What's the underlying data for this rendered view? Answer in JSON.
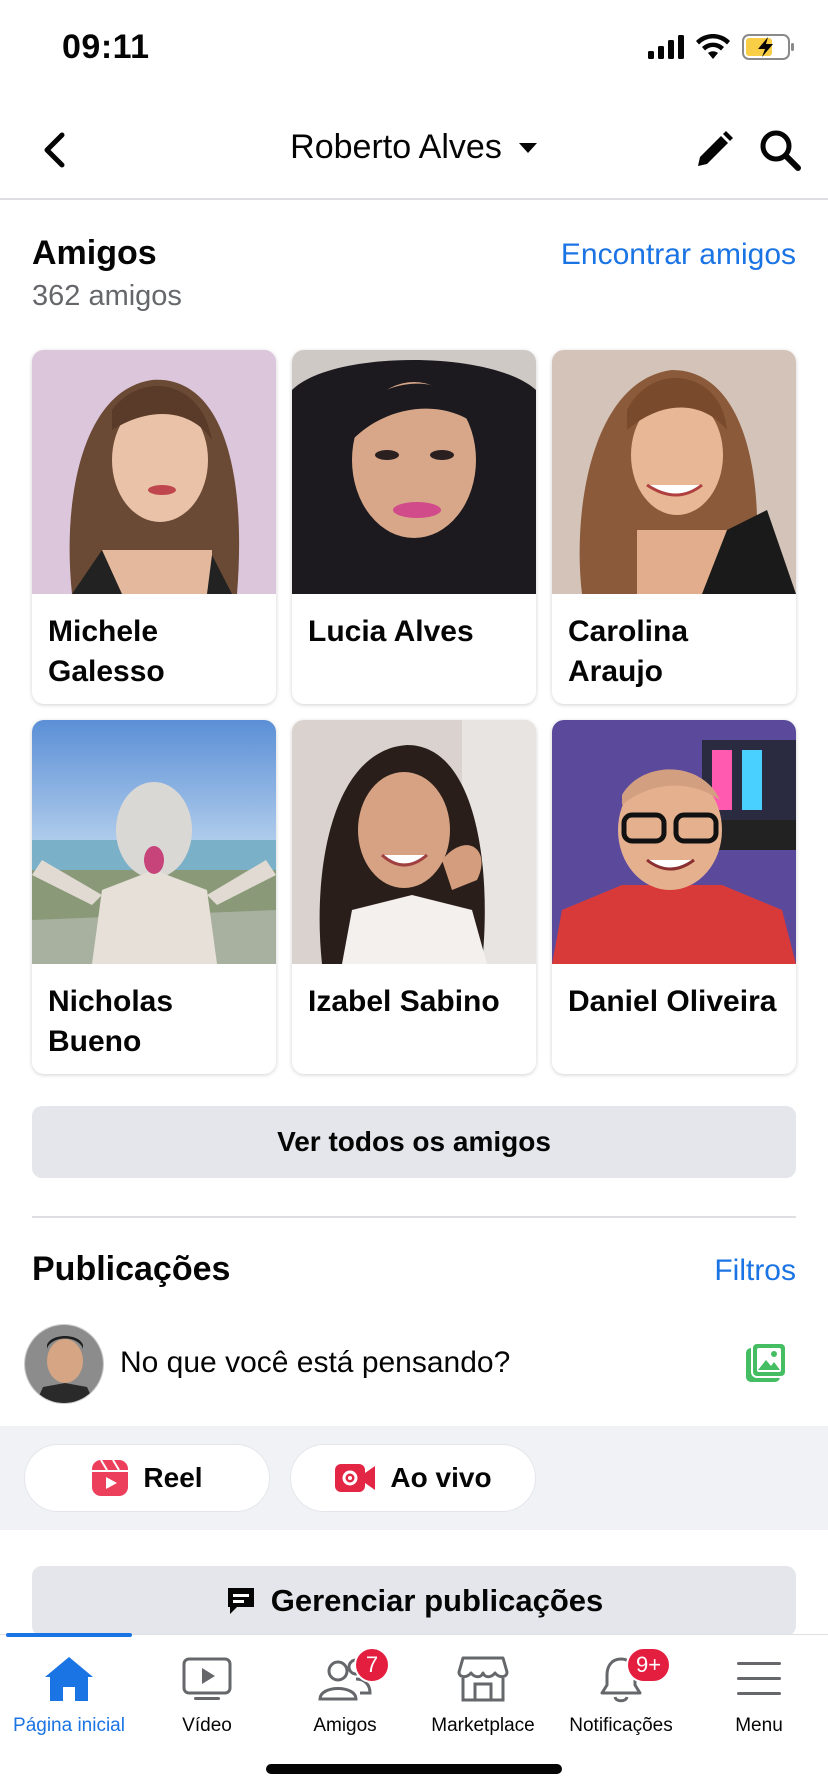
{
  "status_bar": {
    "time": "09:11"
  },
  "header": {
    "title": "Roberto Alves"
  },
  "friends": {
    "title": "Amigos",
    "link": "Encontrar amigos",
    "count": "362 amigos",
    "items": [
      {
        "name": "Michele Galesso",
        "bg": "#d9c0d6"
      },
      {
        "name": "Lucia Alves",
        "bg": "#c8c4c2"
      },
      {
        "name": "Carolina Araujo",
        "bg": "#c9b8ad"
      },
      {
        "name": "Nicholas Bueno",
        "bg": "#7eaad6"
      },
      {
        "name": "Izabel Sabino",
        "bg": "#d8d0cc"
      },
      {
        "name": "Daniel Oliveira",
        "bg": "#6d5aa8"
      }
    ],
    "see_all": "Ver todos os amigos"
  },
  "posts": {
    "title": "Publicações",
    "link": "Filtros",
    "composer_placeholder": "No que você está pensando?",
    "reel_label": "Reel",
    "live_label": "Ao vivo",
    "manage_label": "Gerenciar publicações"
  },
  "tabs": [
    {
      "label": "Página inicial",
      "icon": "home-icon"
    },
    {
      "label": "Vídeo",
      "icon": "video-icon"
    },
    {
      "label": "Amigos",
      "icon": "friends-icon",
      "badge": "7"
    },
    {
      "label": "Marketplace",
      "icon": "marketplace-icon"
    },
    {
      "label": "Notificações",
      "icon": "bell-icon",
      "badge": "9+"
    },
    {
      "label": "Menu",
      "icon": "menu-icon"
    }
  ],
  "colors": {
    "accent": "#1b74e4",
    "badge": "#e41e3f",
    "surface": "#e4e6eb"
  }
}
